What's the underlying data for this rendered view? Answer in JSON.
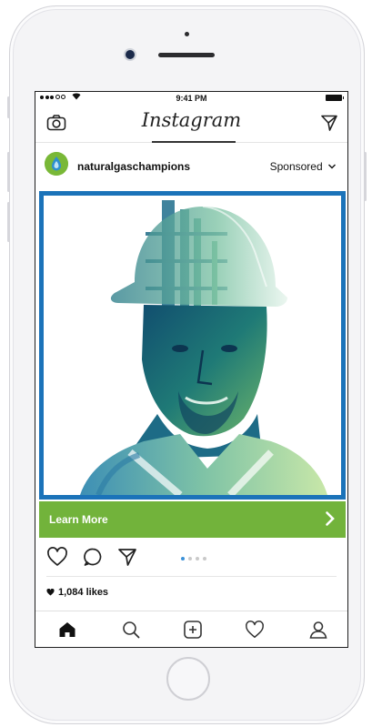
{
  "statusbar": {
    "time": "9:41 PM",
    "signal_icon": "signal-dots-icon",
    "wifi_icon": "wifi-icon",
    "battery_icon": "battery-icon"
  },
  "header": {
    "title": "Instagram",
    "left_icon": "camera-icon",
    "right_icon": "direct-send-icon"
  },
  "post": {
    "username": "naturalgaschampions",
    "sponsored_label": "Sponsored",
    "cta_label": "Learn More",
    "likes": "1,084 likes",
    "carousel_active_index": 1,
    "carousel_count": 4
  },
  "colors": {
    "cta_green": "#72b33b",
    "image_border_blue": "#1b73b9",
    "carousel_active": "#3b91d8"
  },
  "tabbar": {
    "items": [
      "home-icon",
      "search-icon",
      "add-post-icon",
      "activity-heart-icon",
      "profile-icon"
    ]
  }
}
